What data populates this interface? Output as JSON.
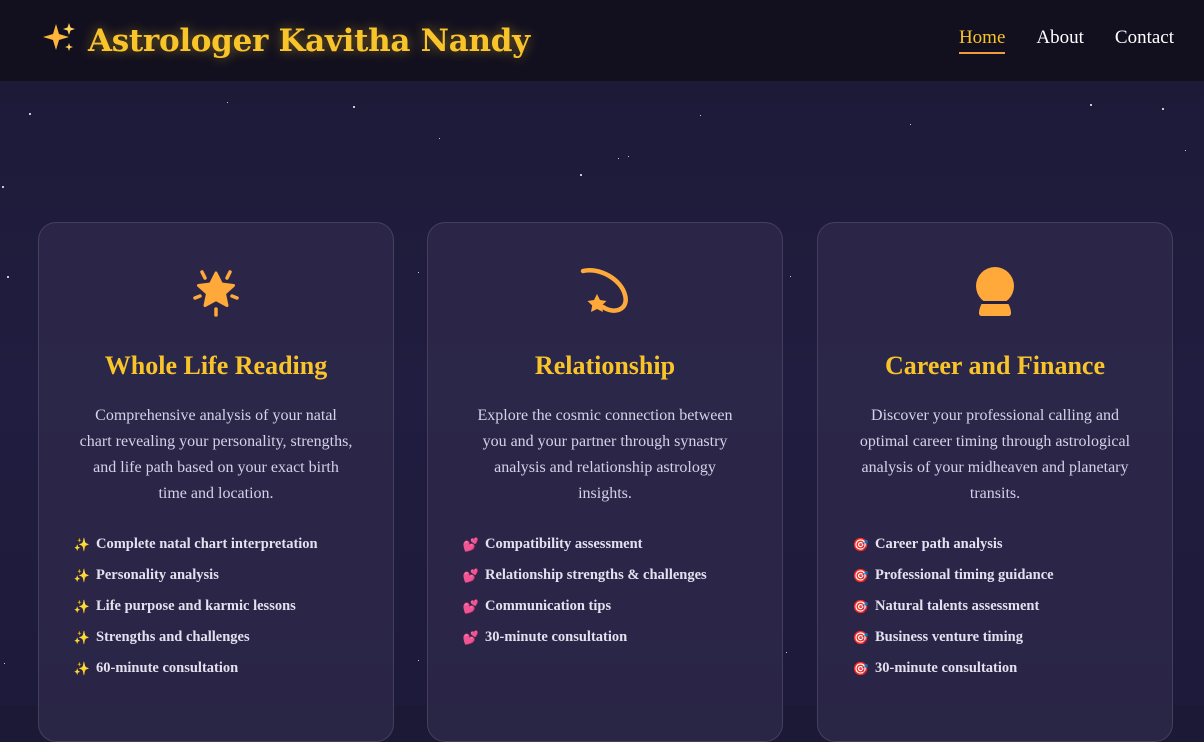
{
  "brand": {
    "icon": "sparkles-icon",
    "name": "Astrologer Kavitha Nandy"
  },
  "nav": {
    "items": [
      {
        "label": "Home",
        "active": true
      },
      {
        "label": "About",
        "active": false
      },
      {
        "label": "Contact",
        "active": false
      }
    ]
  },
  "cards": [
    {
      "icon": "glowing-star-icon",
      "title": "Whole Life Reading",
      "description": "Comprehensive analysis of your natal chart revealing your personality, strengths, and life path based on your exact birth time and location.",
      "bullet_icon": "sparkles-icon",
      "features": [
        "Complete natal chart interpretation",
        "Personality analysis",
        "Life purpose and karmic lessons",
        "Strengths and challenges",
        "60-minute consultation"
      ]
    },
    {
      "icon": "shooting-star-icon",
      "title": "Relationship",
      "description": "Explore the cosmic connection between you and your partner through synastry analysis and relationship astrology insights.",
      "bullet_icon": "two-hearts-icon",
      "features": [
        "Compatibility assessment",
        "Relationship strengths & challenges",
        "Communication tips",
        "30-minute consultation"
      ]
    },
    {
      "icon": "crystal-ball-icon",
      "title": "Career and Finance",
      "description": "Discover your professional calling and optimal career timing through astrological analysis of your midheaven and planetary transits.",
      "bullet_icon": "target-icon",
      "features": [
        "Career path analysis",
        "Professional timing guidance",
        "Natural talents assessment",
        "Business venture timing",
        "30-minute consultation"
      ]
    }
  ],
  "colors": {
    "accent": "#f9c42a",
    "icon": "#ffa93a",
    "background": "#1d1a3a",
    "header": "#12101f"
  }
}
